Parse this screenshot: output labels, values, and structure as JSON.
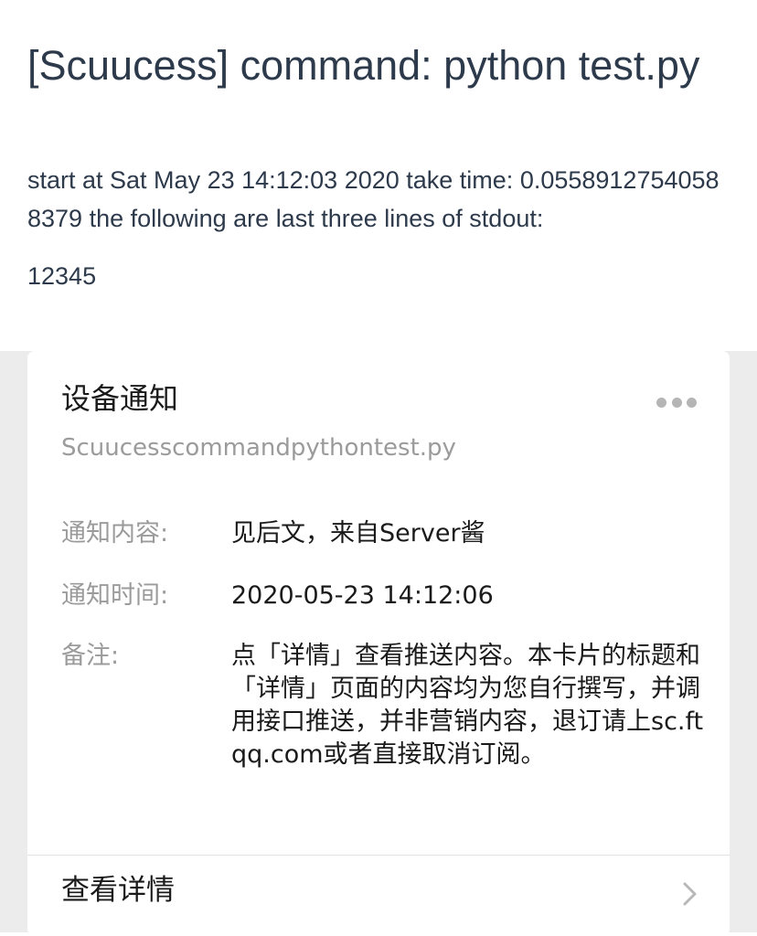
{
  "message": {
    "title": "[Scuucess] command: python test.py",
    "body": "start at Sat May 23 14:12:03 2020 take time: 0.05589127540588379 the following are last three lines of stdout:",
    "output": "12345"
  },
  "card": {
    "title": "设备通知",
    "subtitle": "Scuucesscommandpythontest.py",
    "more_icon": "more-dots-icon",
    "rows": [
      {
        "label": "通知内容:",
        "value": "见后文，来自Server酱"
      },
      {
        "label": "通知时间:",
        "value": "2020-05-23 14:12:06"
      },
      {
        "label": "备注:",
        "value": "点「详情」查看推送内容。本卡片的标题和「详情」页面的内容均为您自行撰写，并调用接口推送，并非营销内容，退订请上sc.ftqq.com或者直接取消订阅。"
      }
    ],
    "detail_label": "查看详情",
    "chevron_icon": "chevron-right-icon"
  },
  "colors": {
    "title_text": "#2d3a4b",
    "muted_text": "#9b9b9b",
    "background": "#ececec"
  }
}
